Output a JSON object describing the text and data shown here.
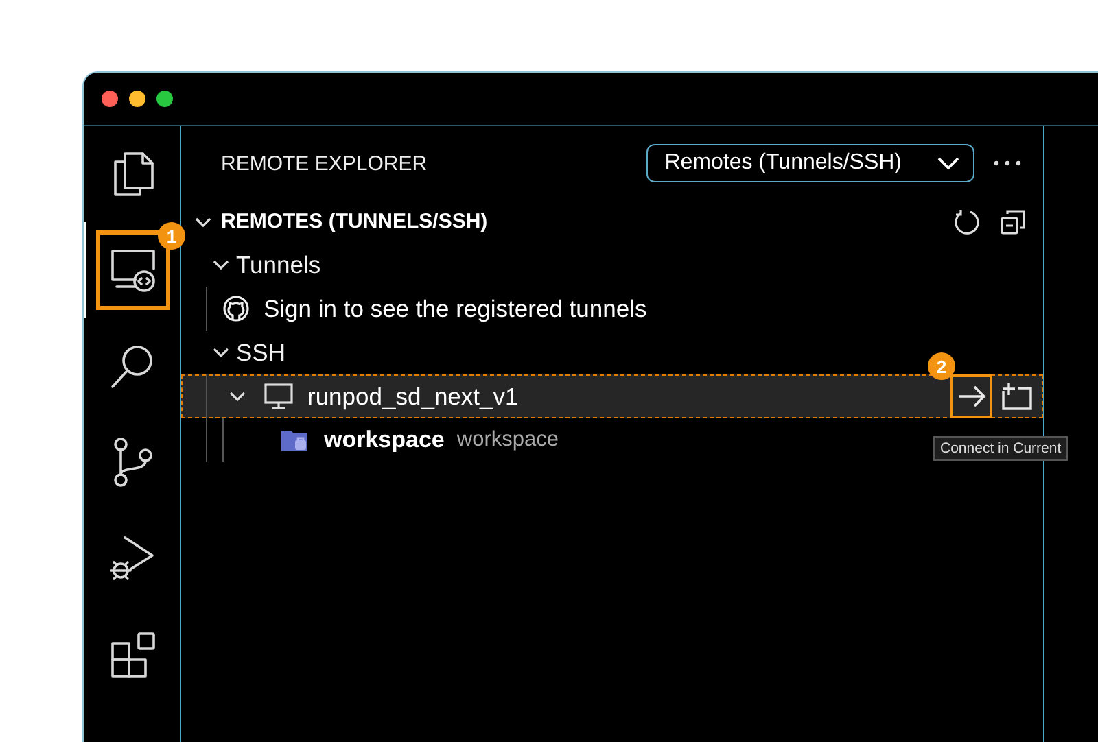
{
  "activity_bar": {
    "items": [
      {
        "kind": "files",
        "selected": false
      },
      {
        "kind": "remote",
        "selected": true,
        "callout": "1"
      },
      {
        "kind": "search",
        "selected": false
      },
      {
        "kind": "source-control",
        "selected": false
      },
      {
        "kind": "run-debug",
        "selected": false
      },
      {
        "kind": "extensions",
        "selected": false
      }
    ]
  },
  "sidebar": {
    "title": "REMOTE EXPLORER",
    "view_picker": "Remotes (Tunnels/SSH)",
    "section": {
      "title": "REMOTES (TUNNELS/SSH)",
      "expanded": true,
      "tree": [
        {
          "kind": "group",
          "label": "Tunnels",
          "expanded": true,
          "selected": false,
          "children": [
            {
              "kind": "message",
              "label": "Sign in to see the registered tunnels",
              "selected": false
            }
          ]
        },
        {
          "kind": "group",
          "label": "SSH",
          "expanded": true,
          "selected": false,
          "children": [
            {
              "kind": "host",
              "label": "runpod_sd_next_v1",
              "expanded": true,
              "selected": true,
              "actions": [
                {
                  "kind": "connect-current",
                  "callout": "2",
                  "tooltip": "Connect in Current"
                },
                {
                  "kind": "connect-new"
                }
              ],
              "children": [
                {
                  "kind": "folder",
                  "label": "workspace",
                  "description": "workspace",
                  "selected": false
                }
              ]
            }
          ]
        }
      ]
    }
  }
}
